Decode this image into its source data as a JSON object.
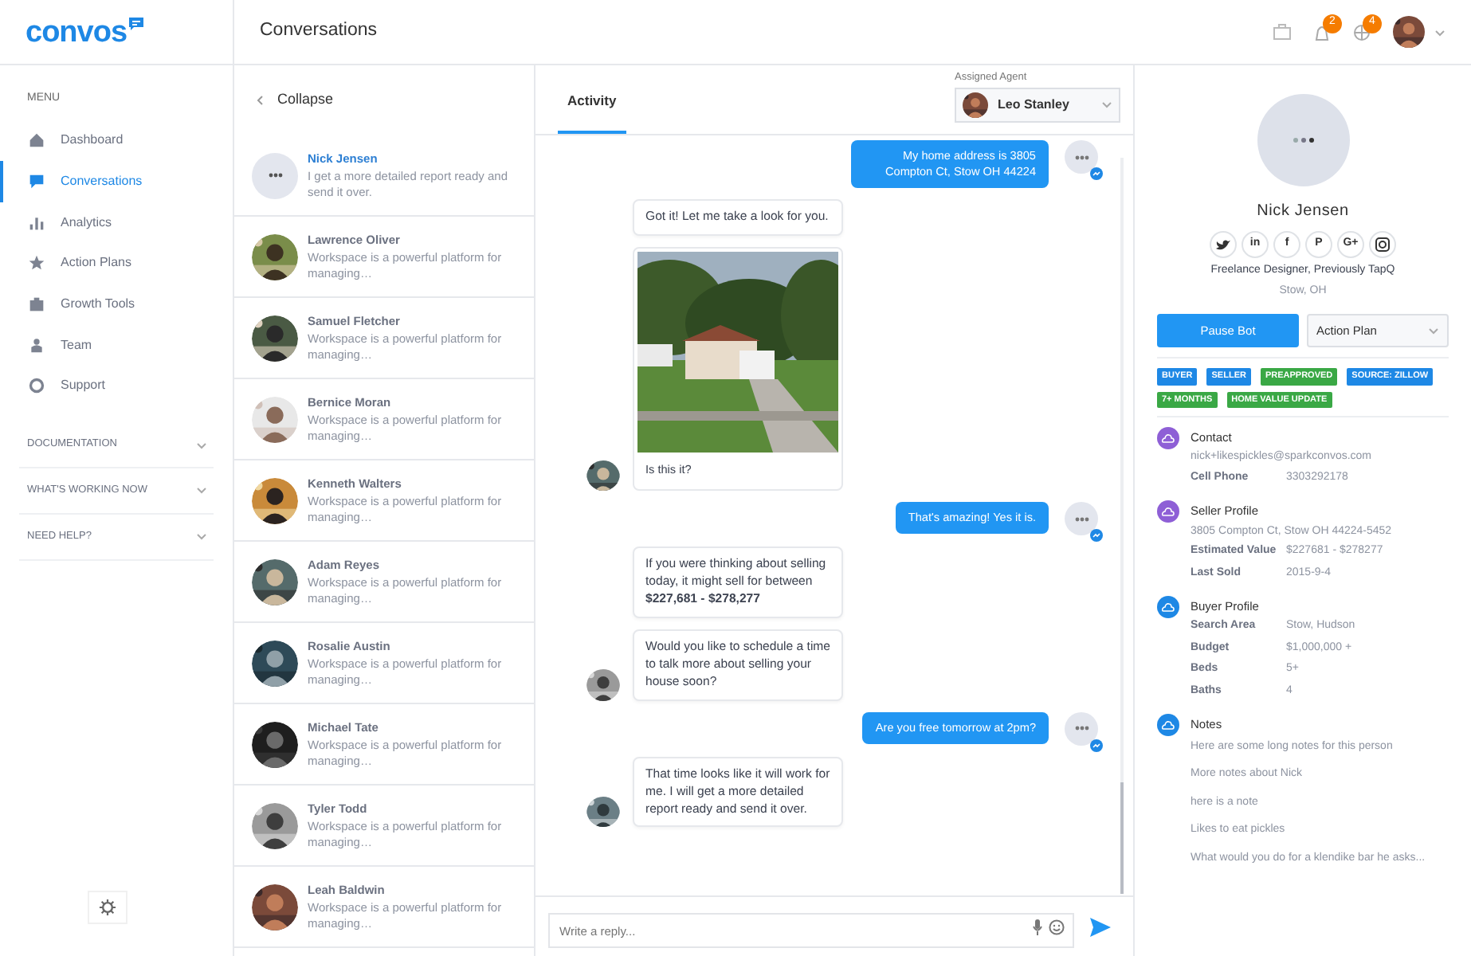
{
  "brand": {
    "logo": "convos"
  },
  "header": {
    "title": "Conversations",
    "badges": [
      {
        "count": "2"
      },
      {
        "count": "4"
      }
    ]
  },
  "sidebar": {
    "menu_label": "MENU",
    "items": [
      {
        "label": "Dashboard",
        "selected": false
      },
      {
        "label": "Conversations",
        "selected": true
      },
      {
        "label": "Analytics",
        "selected": false
      },
      {
        "label": "Action Plans",
        "selected": false
      },
      {
        "label": "Growth Tools",
        "selected": false
      },
      {
        "label": "Team",
        "selected": false
      },
      {
        "label": "Support",
        "selected": false
      }
    ],
    "sections": [
      {
        "label": "DOCUMENTATION",
        "expanded": false
      },
      {
        "label": "WHAT'S WORKING NOW",
        "expanded": false
      },
      {
        "label": "NEED HELP?",
        "expanded": false
      }
    ]
  },
  "conversation_list": {
    "collapse": "Collapse",
    "items": [
      {
        "name": "Nick Jensen",
        "preview": "I get a more detailed report ready and send it over.",
        "kind": "placeholder",
        "selected": true
      },
      {
        "name": "Lawrence Oliver",
        "preview": "Workspace is a powerful platform for managing…",
        "selected": false
      },
      {
        "name": "Samuel Fletcher",
        "preview": "Workspace is a powerful platform for managing…",
        "selected": false
      },
      {
        "name": "Bernice Moran",
        "preview": "Workspace is a powerful platform for managing…",
        "selected": false
      },
      {
        "name": "Kenneth Walters",
        "preview": "Workspace is a powerful platform for managing…",
        "selected": false
      },
      {
        "name": "Adam Reyes",
        "preview": "Workspace is a powerful platform for managing…",
        "selected": false
      },
      {
        "name": "Rosalie Austin",
        "preview": "Workspace is a powerful platform for managing…",
        "selected": false
      },
      {
        "name": "Michael Tate",
        "preview": "Workspace is a powerful platform for managing…",
        "selected": false
      },
      {
        "name": "Tyler Todd",
        "preview": "Workspace is a powerful platform for managing…",
        "selected": false
      },
      {
        "name": "Leah Baldwin",
        "preview": "Workspace is a powerful platform for managing…",
        "selected": false
      }
    ]
  },
  "chat": {
    "tab": "Activity",
    "agent_label": "Assigned Agent",
    "agent": "Leo Stanley",
    "messages": [
      {
        "kind": "outgoing",
        "text": "My home address is 3805 Compton Ct, Stow OH 44224"
      },
      {
        "kind": "incoming",
        "text": "Got it! Let me take a look for you.",
        "avatar": false
      },
      {
        "text": "Is this it?",
        "avatar": true
      },
      {
        "kind": "outgoing",
        "text": "That's amazing! Yes it is."
      },
      {
        "kind": "incoming",
        "text": "If you were thinking about selling today, it might sell for between **$227,681 - $278,277**",
        "avatar": false
      },
      {
        "kind": "incoming",
        "text": "Would you like to schedule a time to talk more about selling your house soon?",
        "avatar": true
      },
      {
        "kind": "outgoing",
        "text": "Are you free tomorrow at 2pm?"
      },
      {
        "kind": "incoming",
        "text": "That time looks like it will work for me. I will get a more detailed report ready and send it over.",
        "avatar": true
      }
    ],
    "reply_placeholder": "Write a reply..."
  },
  "profile": {
    "name": "Nick Jensen",
    "socials": [
      {
        "kind": "bird"
      },
      {
        "kind": "text",
        "glyph": "in"
      },
      {
        "kind": "text",
        "glyph": "f"
      },
      {
        "kind": "text",
        "glyph": "P"
      },
      {
        "kind": "text",
        "glyph": "G+"
      },
      {
        "kind": "camera"
      }
    ],
    "headline": "Freelance Designer, Previously TapQ",
    "location": "Stow, OH",
    "pause_button": "Pause Bot",
    "action_select": "Action Plan",
    "tags": [
      {
        "label": "BUYER",
        "color": "#1e88e5"
      },
      {
        "label": "SELLER",
        "color": "#1e88e5"
      },
      {
        "label": "PREAPPROVED",
        "color": "#3aa845"
      },
      {
        "label": "SOURCE: ZILLOW",
        "color": "#1e88e5"
      },
      {
        "label": "7+ MONTHS",
        "color": "#3aa845"
      },
      {
        "label": "HOME VALUE UPDATE",
        "color": "#3aa845"
      }
    ],
    "sections": [
      {
        "title": "Contact",
        "color": "#8e5fd6",
        "entries": [
          {
            "kind": "line",
            "text": "nick+likespickles@sparkconvos.com"
          },
          {
            "kind": "pair",
            "label": "Cell Phone",
            "value": "3303292178"
          }
        ]
      },
      {
        "title": "Seller Profile",
        "color": "#8e5fd6",
        "entries": [
          {
            "kind": "line",
            "text": "3805 Compton Ct, Stow OH 44224-5452"
          },
          {
            "kind": "pair",
            "label": "Estimated Value",
            "value": "$227681 -  $278277"
          },
          {
            "kind": "pair",
            "label": "Last Sold",
            "value": "2015-9-4"
          }
        ]
      },
      {
        "title": "Buyer Profile",
        "color": "#1e88e5",
        "entries": [
          {
            "kind": "pair",
            "label": "Search Area",
            "value": "Stow, Hudson"
          },
          {
            "kind": "pair",
            "label": "Budget",
            "value": "$1,000,000 +"
          },
          {
            "kind": "pair",
            "label": "Beds",
            "value": "5+"
          },
          {
            "kind": "pair",
            "label": "Baths",
            "value": "4"
          }
        ]
      },
      {
        "title": "Notes",
        "color": "#1e88e5",
        "entries": [
          {
            "kind": "note",
            "text": "Here are some long notes for this person"
          },
          {
            "kind": "note",
            "text": "More notes about Nick"
          },
          {
            "kind": "note",
            "text": "here is a note"
          },
          {
            "kind": "note",
            "text": "Likes to eat pickles"
          },
          {
            "kind": "note",
            "text": "What would you do for a klendike bar he asks..."
          }
        ]
      }
    ]
  }
}
